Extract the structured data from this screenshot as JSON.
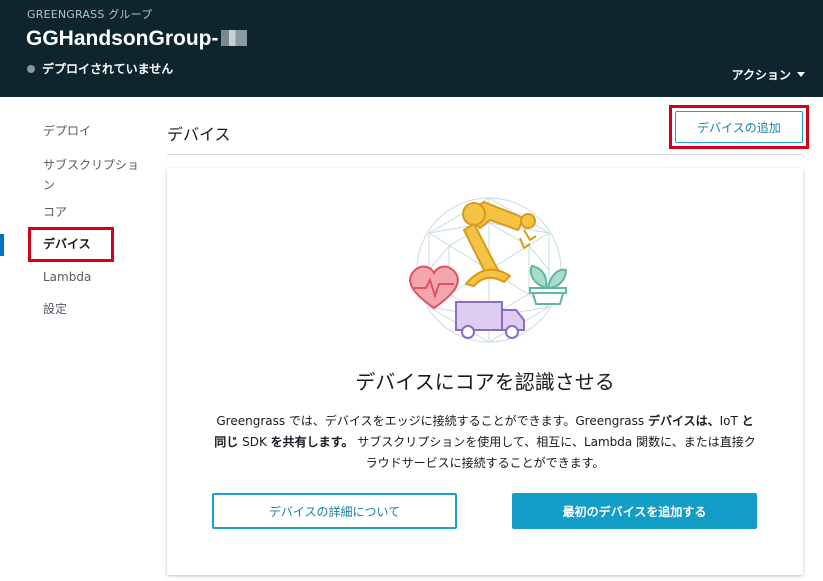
{
  "header": {
    "breadcrumb": "GREENGRASS グループ",
    "group_name": "GGHandsonGroup-",
    "status": "デプロイされていません",
    "actions_label": "アクション"
  },
  "sidebar": {
    "items": [
      {
        "label": "デプロイ"
      },
      {
        "label": "サブスクリプション"
      },
      {
        "label": "コア"
      },
      {
        "label": "デバイス"
      },
      {
        "label": "Lambda"
      },
      {
        "label": "設定"
      }
    ],
    "active_index": 3
  },
  "main": {
    "title": "デバイス",
    "add_device_label": "デバイスの追加"
  },
  "card": {
    "title": "デバイスにコアを認識させる",
    "desc_1": "Greengrass では、デバイスをエッジに接続することができます。Greengrass ",
    "desc_bold_1": "デバイスは、",
    "desc_2": "IoT ",
    "desc_bold_2": "と同じ",
    "desc_3": " SDK ",
    "desc_bold_3": "を共有します。",
    "desc_4": " サブスクリプションを使用して、相互に、Lambda 関数に、または直接クラウドサービスに接続することができます。",
    "learn_button": "デバイスの詳細について",
    "first_device_button": "最初のデバイスを追加する"
  },
  "colors": {
    "header_bg": "#0e252d",
    "accent": "#139dc7",
    "highlight": "#d0021b",
    "robot_arm": "#f5c343",
    "heart": "#e0525f",
    "plant": "#5fb59d",
    "truck": "#a98bd1"
  },
  "icons": [
    "status-dot-icon",
    "caret-down-icon",
    "robot-arm-icon",
    "heart-monitor-icon",
    "plant-icon",
    "truck-icon",
    "geodesic-globe-icon"
  ]
}
